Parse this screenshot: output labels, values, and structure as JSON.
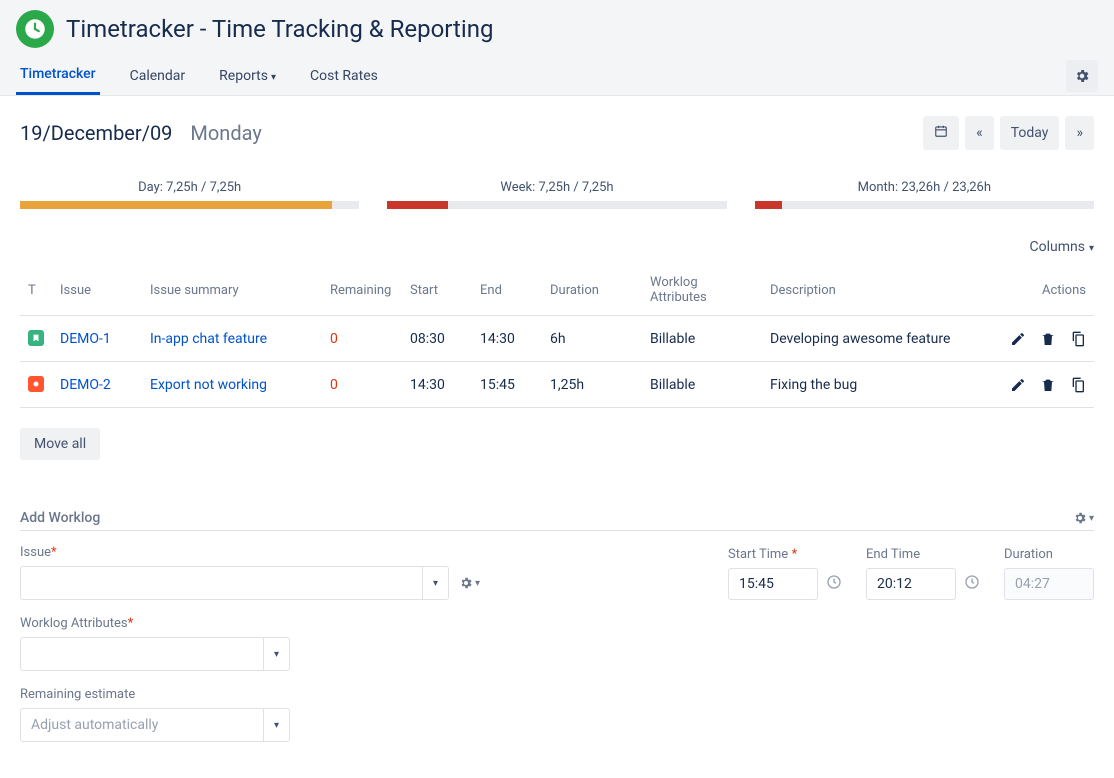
{
  "header": {
    "title": "Timetracker - Time Tracking & Reporting"
  },
  "nav": {
    "tabs": [
      "Timetracker",
      "Calendar",
      "Reports",
      "Cost Rates"
    ],
    "activeIndex": 0,
    "dropdownIndices": [
      2
    ]
  },
  "dateBar": {
    "date": "19/December/09",
    "dayName": "Monday",
    "todayLabel": "Today"
  },
  "progress": [
    {
      "label": "Day: 7,25h / 7,25h",
      "fillPercent": 92,
      "color": "#e8a43a"
    },
    {
      "label": "Week: 7,25h / 7,25h",
      "fillPercent": 18,
      "color": "#c9372c"
    },
    {
      "label": "Month: 23,26h / 23,26h",
      "fillPercent": 8,
      "color": "#c9372c"
    }
  ],
  "columnsLabel": "Columns",
  "tableHeaders": {
    "type": "T",
    "issue": "Issue",
    "summary": "Issue summary",
    "remaining": "Remaining",
    "start": "Start",
    "end": "End",
    "duration": "Duration",
    "attributes": "Worklog Attributes",
    "description": "Description",
    "actions": "Actions"
  },
  "rows": [
    {
      "type": "story",
      "issue": "DEMO-1",
      "summary": "In-app chat feature",
      "remaining": "0",
      "start": "08:30",
      "end": "14:30",
      "duration": "6h",
      "attributes": "Billable",
      "description": "Developing awesome feature"
    },
    {
      "type": "bug",
      "issue": "DEMO-2",
      "summary": "Export not working",
      "remaining": "0",
      "start": "14:30",
      "end": "15:45",
      "duration": "1,25h",
      "attributes": "Billable",
      "description": "Fixing the bug"
    }
  ],
  "moveAllLabel": "Move all",
  "addWorklog": {
    "title": "Add Worklog",
    "issueLabel": "Issue",
    "startTimeLabel": "Start Time",
    "endTimeLabel": "End Time",
    "durationLabel": "Duration",
    "attributesLabel": "Worklog Attributes",
    "remainingLabel": "Remaining estimate",
    "remainingValue": "Adjust automatically",
    "startTime": "15:45",
    "endTime": "20:12",
    "duration": "04:27"
  }
}
